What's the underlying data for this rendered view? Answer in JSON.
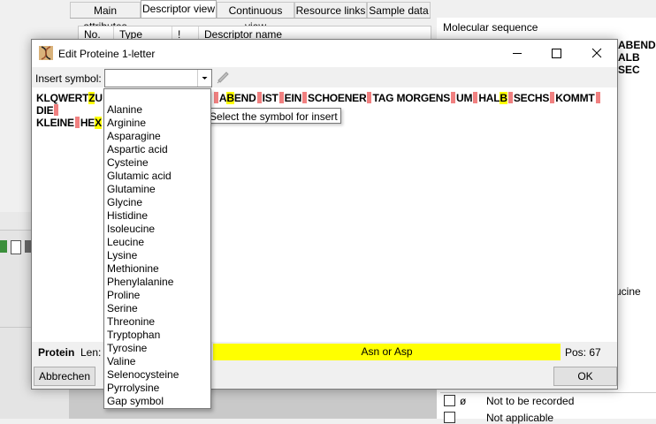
{
  "background": {
    "tabs": [
      "Main attributes",
      "Descriptor view",
      "Continuous view",
      "Resource links",
      "Sample data"
    ],
    "active_tab": "Descriptor view",
    "table_headers": [
      "No.",
      "Type",
      "!",
      "Descriptor name"
    ],
    "molecular_sequence_label": "Molecular sequence",
    "mol_seq_fragment_1": "ABEND",
    "mol_seq_fragment_2": "ALB SEC",
    "leucine_text": "ucine",
    "row1_symbol": "ø",
    "row1_text": "Not to be recorded",
    "row2_text": "Not applicable"
  },
  "dialog": {
    "title": "Edit Proteine 1-letter",
    "insert_label": "Insert symbol:",
    "insert_value": "",
    "tooltip": "Select the symbol for insert",
    "status_type": "Protein",
    "status_len_label": "Len:",
    "status_center": "Asn or Asp",
    "status_pos": "Pos:  67",
    "cancel_label": "Abbrechen",
    "ok_label": "OK",
    "accent_yellow": "#ffff00",
    "separator_red": "#f08080"
  },
  "sequence_lines": [
    "KLQWERTZU ... ABEND IST EIN SCHOENER TAG MORGENS UM HALB SECHS KOMMT DIE",
    "KLEINE HEX"
  ],
  "dropdown_items": [
    "Alanine",
    "Arginine",
    "Asparagine",
    "Aspartic acid",
    "Cysteine",
    "Glutamic acid",
    "Glutamine",
    "Glycine",
    "Histidine",
    "Isoleucine",
    "Leucine",
    "Lysine",
    "Methionine",
    "Phenylalanine",
    "Proline",
    "Serine",
    "Threonine",
    "Tryptophan",
    "Tyrosine",
    "Valine",
    "Selenocysteine",
    "Pyrrolysine",
    "Gap symbol"
  ]
}
